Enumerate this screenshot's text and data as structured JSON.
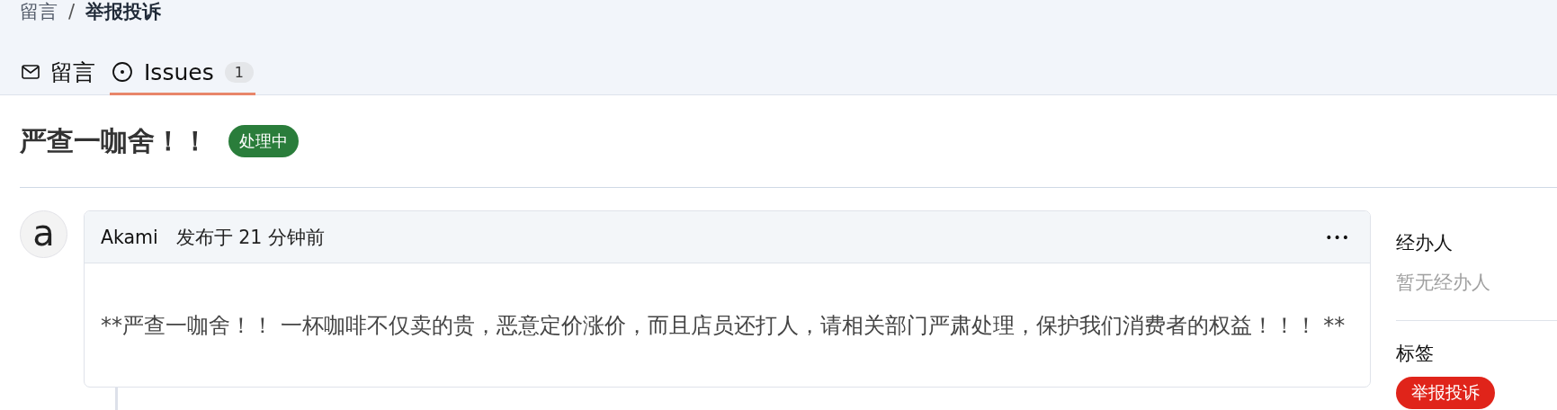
{
  "breadcrumb": [
    {
      "label": "留言",
      "current": false
    },
    {
      "separator": "/",
      "label": "举报投诉",
      "current": true
    }
  ],
  "tabs": [
    {
      "kind": "mail",
      "label": "留言",
      "selected": false
    },
    {
      "kind": "issue",
      "label": "Issues",
      "count": "1",
      "selected": true
    }
  ],
  "issue": {
    "title": "严查一咖舍！！",
    "status": {
      "label": "处理中",
      "color": "#2a7d3b"
    }
  },
  "comment": {
    "avatar": "a",
    "author": "Akami",
    "time": "发布于 21 分钟前",
    "menu": "•••",
    "body": "**严查一咖舍！！ 一杯咖啡不仅卖的贵，恶意定价涨价，而且店员还打人，请相关部门严肃处理，保护我们消费者的权益！！！ **"
  },
  "sidebar": {
    "assignee": {
      "heading": "经办人",
      "empty": "暂无经办人"
    },
    "labels": {
      "heading": "标签",
      "items": [
        {
          "label": "举报投诉",
          "color": "#e0241a"
        }
      ]
    }
  }
}
